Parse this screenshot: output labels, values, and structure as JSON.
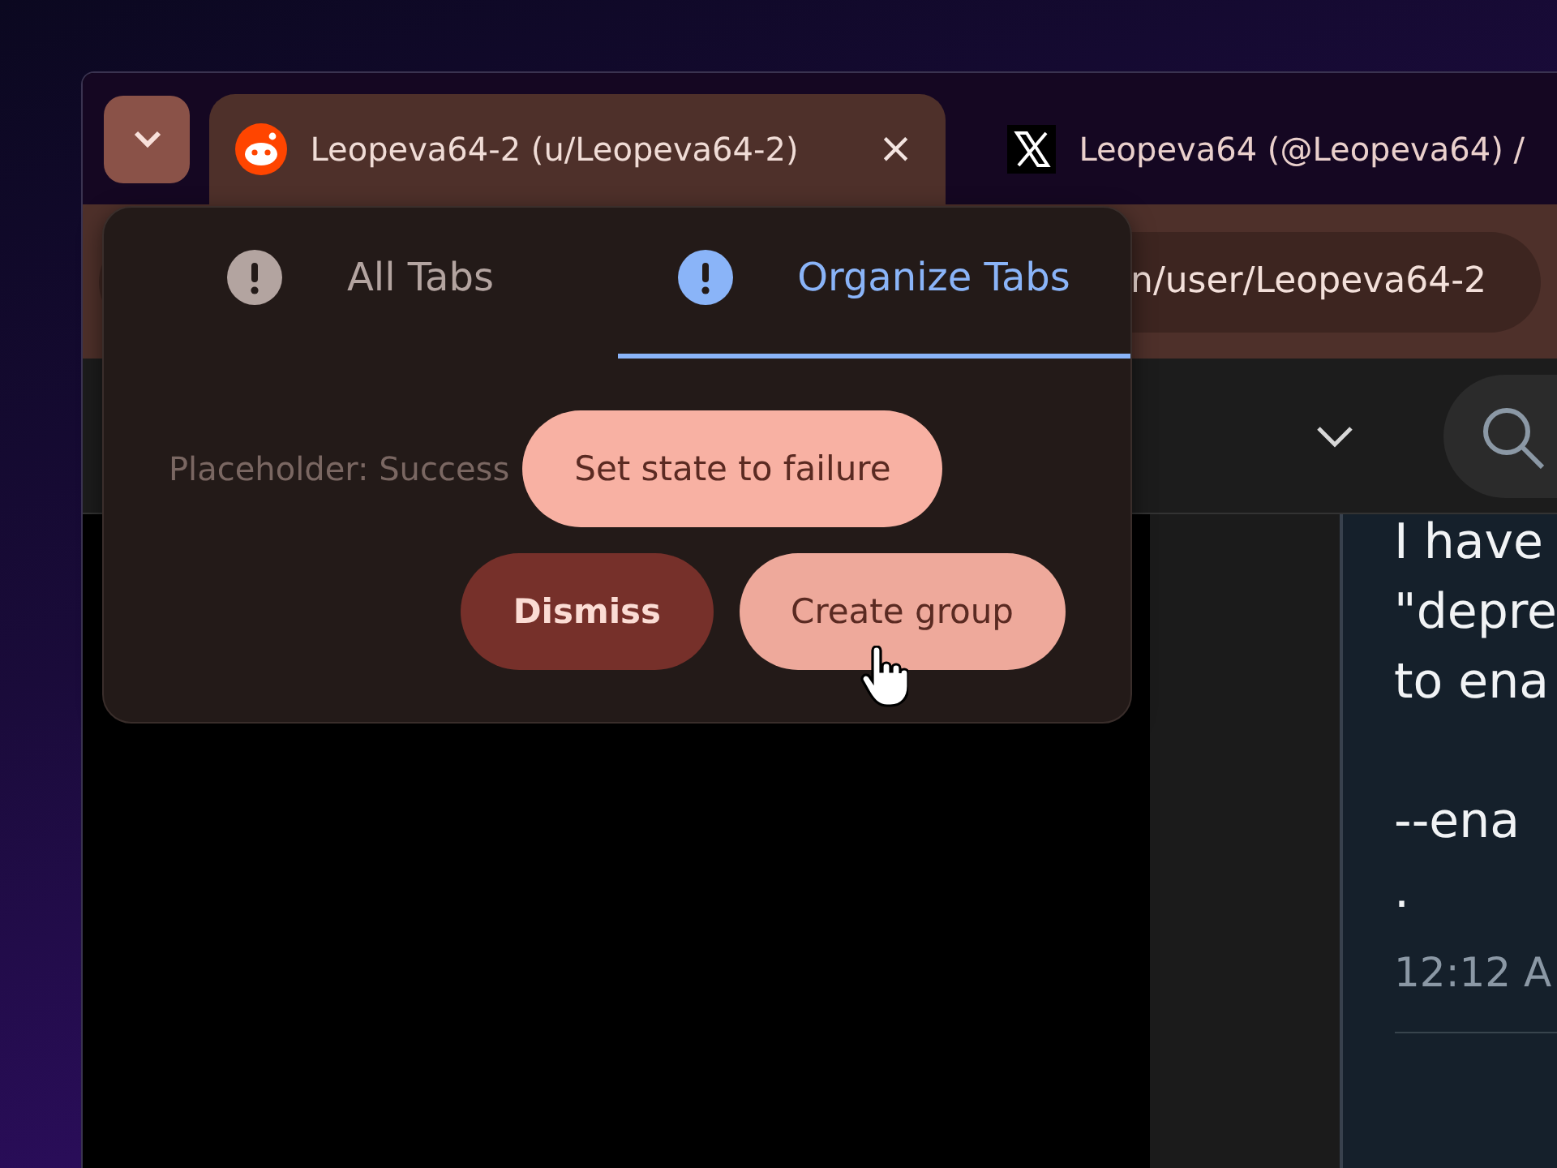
{
  "browser_tabs": [
    {
      "title": "Leopeva64-2 (u/Leopeva64-2)",
      "kind": "reddit",
      "selected": true,
      "close": "×"
    },
    {
      "title": "Leopeva64 (@Leopeva64) /",
      "kind": "x",
      "selected": false
    }
  ],
  "address_bar": {
    "value": "n/user/Leopeva64-2"
  },
  "popup": {
    "tabs": [
      {
        "label": "All Tabs",
        "selected": false
      },
      {
        "label": "Organize Tabs",
        "selected": true
      }
    ],
    "status": "Placeholder: Success",
    "buttons": [
      {
        "label": "Set state to failure",
        "kind": "light"
      },
      {
        "label": "Dismiss",
        "kind": "dark"
      },
      {
        "label": "Create group",
        "kind": "hover"
      }
    ]
  },
  "post": {
    "lines": [
      "I have",
      "\"depre",
      "to ena",
      "--ena",
      "."
    ],
    "time": "12:12 A"
  }
}
